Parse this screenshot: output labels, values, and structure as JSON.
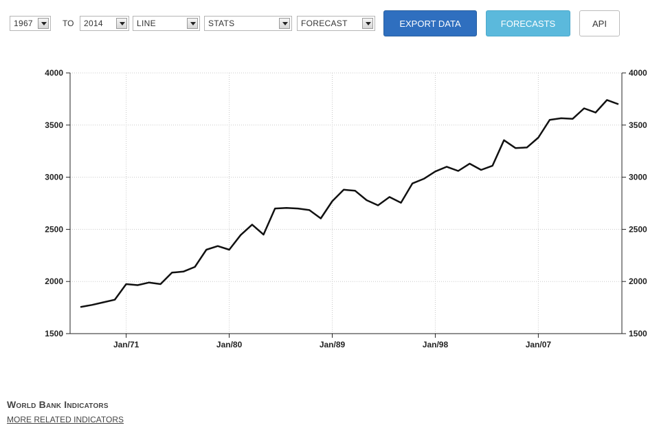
{
  "toolbar": {
    "from_year": "1967",
    "to_label": "TO",
    "to_year": "2014",
    "chart_type": "LINE",
    "stats": "STATS",
    "forecast": "FORECAST",
    "export_label": "EXPORT DATA",
    "forecasts_label": "FORECASTS",
    "api_label": "API"
  },
  "footer": {
    "title": "World Bank Indicators",
    "link": "MORE RELATED INDICATORS"
  },
  "chart_data": {
    "type": "line",
    "x_tick_labels": [
      "Jan/71",
      "Jan/80",
      "Jan/89",
      "Jan/98",
      "Jan/07"
    ],
    "x_tick_years": [
      1971,
      1980,
      1989,
      1998,
      2007
    ],
    "ylim": [
      1500,
      4000
    ],
    "y_ticks": [
      1500,
      2000,
      2500,
      3000,
      3500,
      4000
    ],
    "dual_y_axis": true,
    "grid": true,
    "series": [
      {
        "color": "#111111",
        "x": [
          1967,
          1968,
          1969,
          1970,
          1971,
          1972,
          1973,
          1974,
          1975,
          1976,
          1977,
          1978,
          1979,
          1980,
          1981,
          1982,
          1983,
          1984,
          1985,
          1986,
          1987,
          1988,
          1989,
          1990,
          1991,
          1992,
          1993,
          1994,
          1995,
          1996,
          1997,
          1998,
          1999,
          2000,
          2001,
          2002,
          2003,
          2004,
          2005,
          2006,
          2007,
          2008,
          2009,
          2010,
          2011,
          2012,
          2013,
          2014
        ],
        "values": [
          1755,
          1775,
          1800,
          1825,
          1975,
          1965,
          1990,
          1975,
          2085,
          2095,
          2140,
          2305,
          2340,
          2305,
          2445,
          2545,
          2450,
          2700,
          2705,
          2700,
          2685,
          2605,
          2770,
          2880,
          2870,
          2780,
          2730,
          2810,
          2755,
          2940,
          2985,
          3055,
          3100,
          3060,
          3130,
          3070,
          3110,
          3355,
          3280,
          3285,
          3380,
          3550,
          3565,
          3560,
          3660,
          3620,
          3740,
          3700
        ]
      }
    ]
  }
}
